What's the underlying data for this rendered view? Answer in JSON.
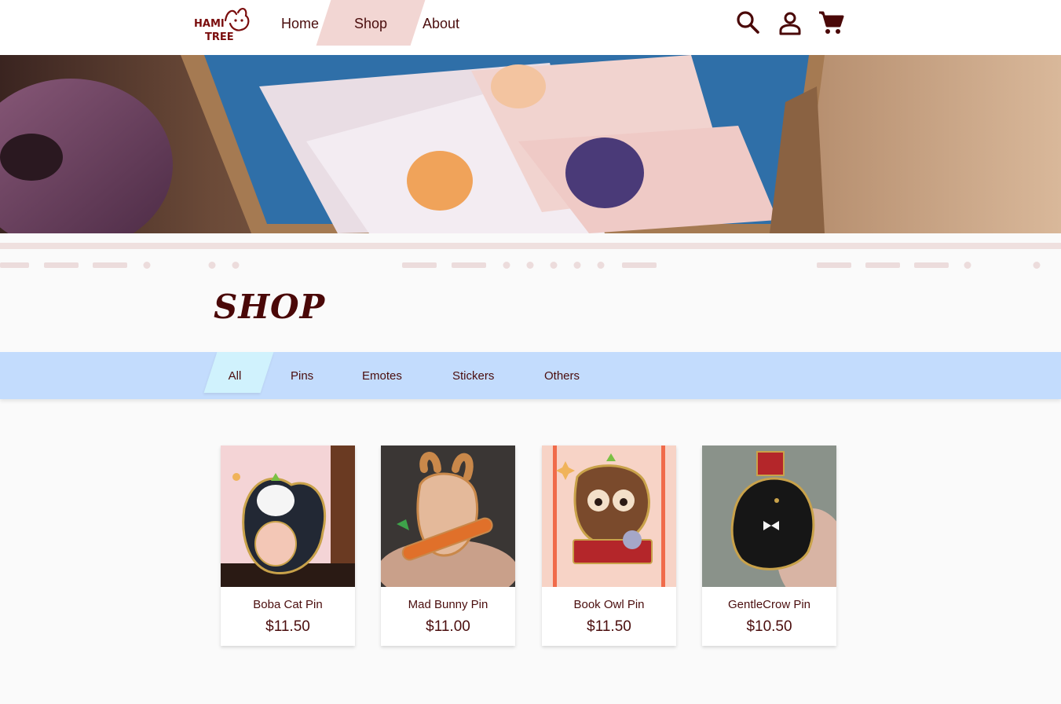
{
  "brand": {
    "logo_text": "HAMI TREE"
  },
  "nav": {
    "items": [
      {
        "label": "Home"
      },
      {
        "label": "Shop",
        "active": true
      },
      {
        "label": "About"
      }
    ],
    "icons": [
      "search-icon",
      "user-icon",
      "cart-icon"
    ]
  },
  "page": {
    "title": "SHOP"
  },
  "filters": {
    "items": [
      {
        "label": "All",
        "active": true
      },
      {
        "label": "Pins"
      },
      {
        "label": "Emotes"
      },
      {
        "label": "Stickers"
      },
      {
        "label": "Others"
      }
    ]
  },
  "products": [
    {
      "name": "Boba Cat Pin",
      "price": "$11.50"
    },
    {
      "name": "Mad Bunny Pin",
      "price": "$11.00"
    },
    {
      "name": "Book Owl Pin",
      "price": "$11.50"
    },
    {
      "name": "GentleCrow Pin",
      "price": "$10.50"
    }
  ],
  "colors": {
    "accent_text": "#4a0d0d",
    "nav_active": "#f2d6d3",
    "filter_bar": "#c3dcfd",
    "filter_active": "#d0f2fd"
  }
}
